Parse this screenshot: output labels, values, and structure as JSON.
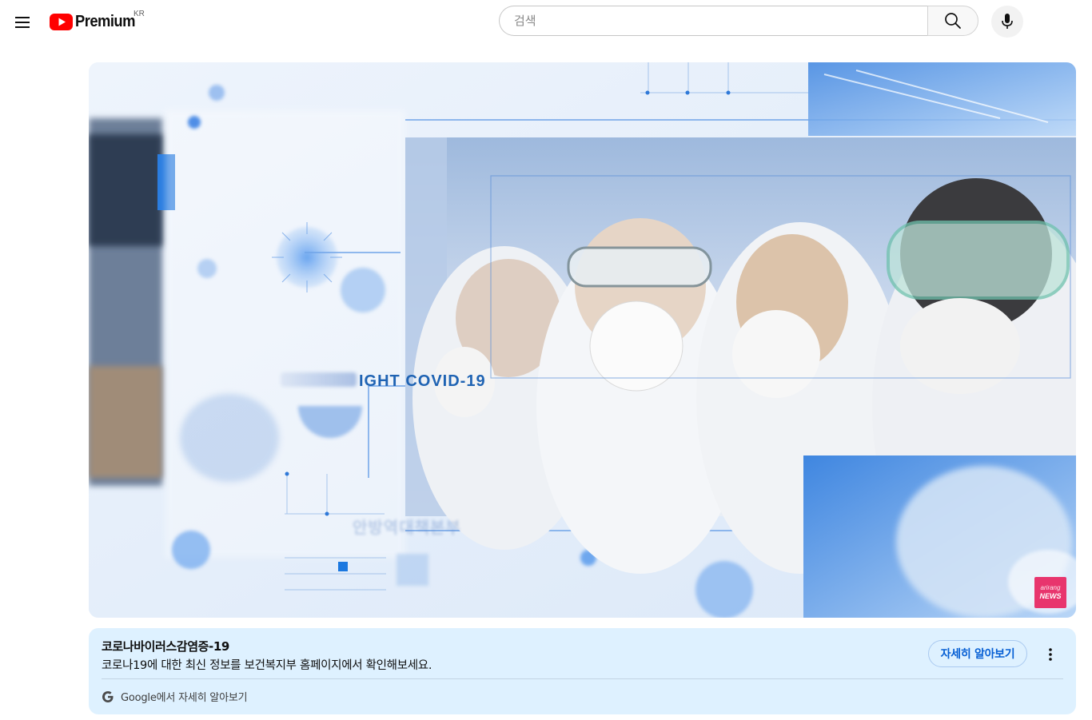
{
  "header": {
    "menu_icon": "hamburger-menu-icon",
    "logo_text": "Premium",
    "logo_region": "KR",
    "brand_color": "#ff0000",
    "search_placeholder": "검색",
    "search_icon": "search-icon",
    "mic_icon": "microphone-icon"
  },
  "ad": {
    "overlay_text": "IGHT COVID-19",
    "korean_overlay_text": "안방역대책본부",
    "broadcaster_logo": {
      "top": "arirang",
      "bottom": "NEWS",
      "color": "#e8356d"
    }
  },
  "info_card": {
    "title": "코로나바이러스감염증-19",
    "description": "코로나19에 대한 최신 정보를 보건복지부 홈페이지에서 확인해보세요.",
    "cta_label": "자세히 알아보기",
    "more_icon": "more-vertical-icon",
    "source_icon": "google-g-icon",
    "source_label": "Google에서 자세히 알아보기",
    "background_color": "#def1ff",
    "accent_color": "#065fd4"
  }
}
